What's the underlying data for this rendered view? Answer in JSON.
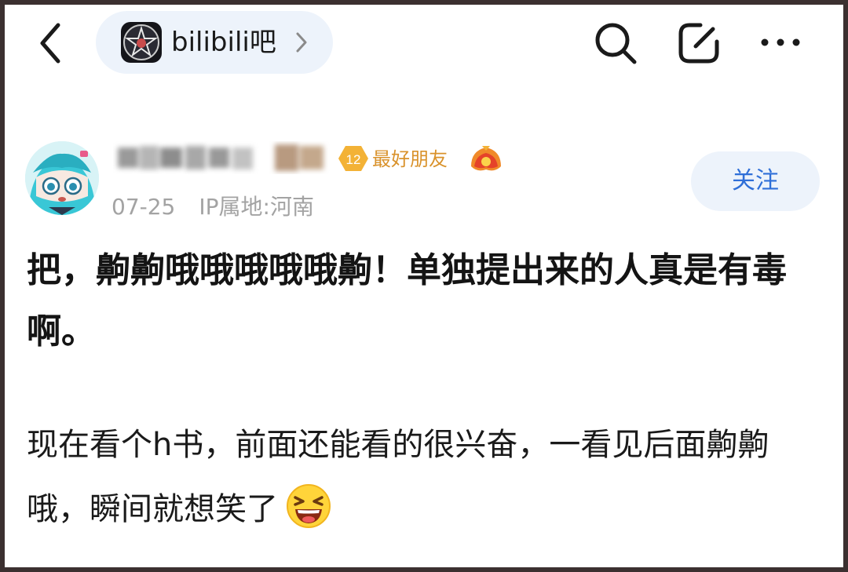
{
  "header": {
    "forum_name": "bilibili吧",
    "icons": [
      "back-arrow-icon",
      "chevron-right-icon",
      "search-icon",
      "edit-icon",
      "more-icon"
    ]
  },
  "author": {
    "level": "12",
    "relation_tag": "最好朋友",
    "date": "07-25",
    "ip_location": "IP属地:河南",
    "follow_label": "关注"
  },
  "post": {
    "title": "把，齁齁哦哦哦哦哦齁！单独提出来的人真是有毒啊。",
    "body": "现在看个h书，前面还能看的很兴奋，一看见后面齁齁哦，瞬间就想笑了",
    "emoji": "laughing-emoji"
  },
  "colors": {
    "pill_bg": "#edf3fb",
    "follow_text": "#2f6fd8",
    "tag_orange": "#d9922b",
    "meta_gray": "#a3a3a3"
  }
}
